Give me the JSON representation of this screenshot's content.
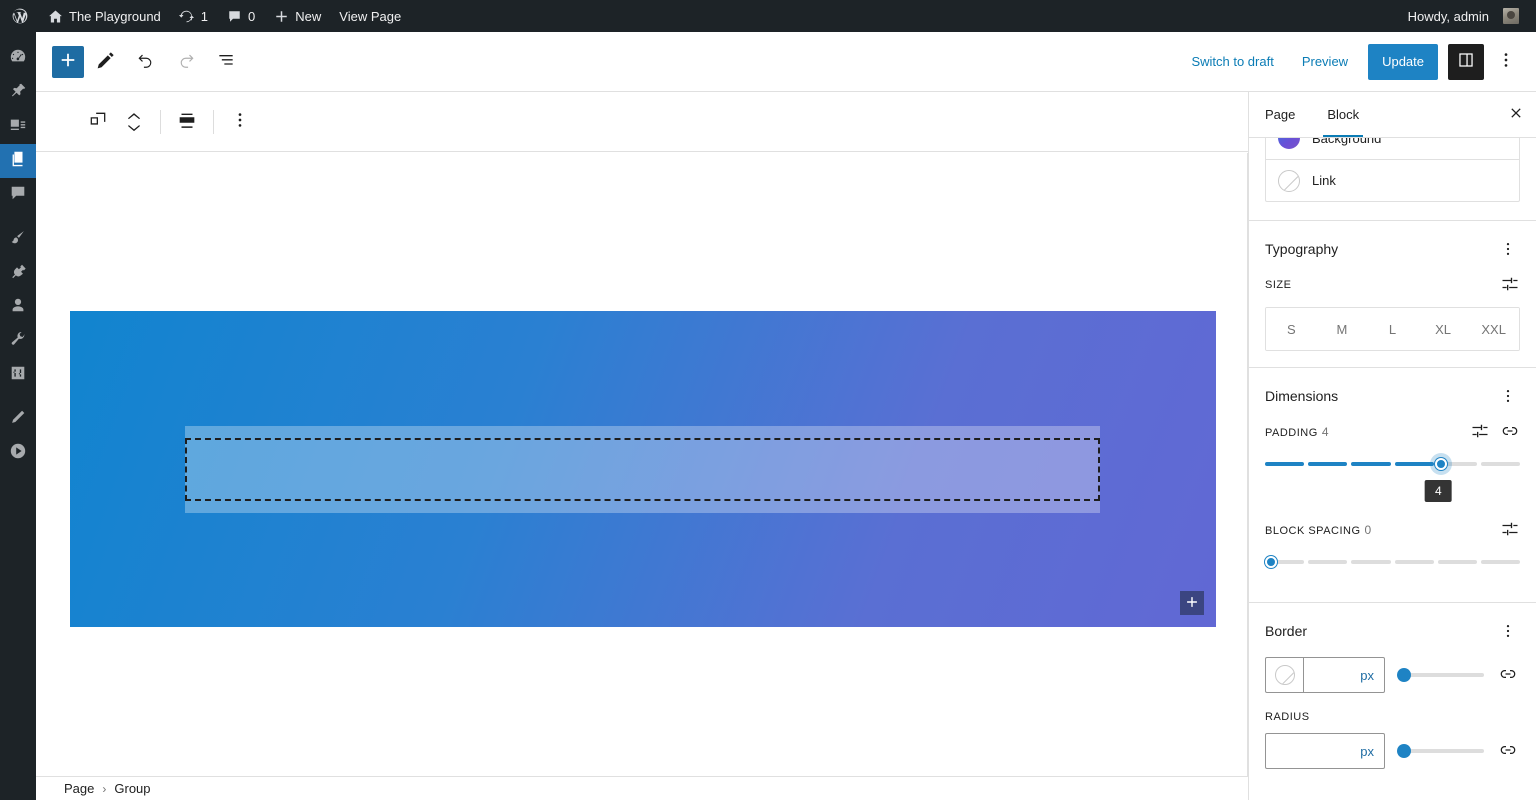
{
  "adminbar": {
    "logo_icon": "wordpress-logo-icon",
    "site_icon": "home-icon",
    "site_name": "The Playground",
    "revisions_icon": "updates-icon",
    "revisions_count": "1",
    "comments_icon": "comment-bubble-icon",
    "comments_count": "0",
    "new_icon": "plus-icon",
    "new_label": "New",
    "view_page_label": "View Page",
    "howdy": "Howdy, admin",
    "avatar_name": "user-avatar"
  },
  "adminmenu": {
    "items": [
      {
        "name": "dashboard",
        "icon": "dashboard-icon",
        "current": false
      },
      {
        "name": "posts",
        "icon": "pin-icon",
        "current": false
      },
      {
        "name": "media",
        "icon": "media-icon",
        "current": false
      },
      {
        "name": "pages",
        "icon": "pages-icon",
        "current": true
      },
      {
        "name": "comments",
        "icon": "comment-icon",
        "current": false
      },
      {
        "name": "appearance",
        "icon": "paintbrush-icon",
        "current": false
      },
      {
        "name": "plugins",
        "icon": "plug-icon",
        "current": false
      },
      {
        "name": "users",
        "icon": "user-icon",
        "current": false
      },
      {
        "name": "tools",
        "icon": "wrench-icon",
        "current": false
      },
      {
        "name": "settings",
        "icon": "sliders-icon",
        "current": false
      },
      {
        "name": "edit",
        "icon": "pencil-icon",
        "current": false
      },
      {
        "name": "player",
        "icon": "play-icon",
        "current": false
      }
    ]
  },
  "header": {
    "add_block_icon": "plus-icon",
    "tools_icon": "pencil-icon",
    "undo_icon": "undo-icon",
    "redo_icon": "redo-icon",
    "list_view_icon": "list-view-icon",
    "switch_to_draft": "Switch to draft",
    "preview": "Preview",
    "update": "Update",
    "sidebar_toggle_icon": "sidebar-panel-icon",
    "options_icon": "more-options-icon",
    "accent_color": "#1e83c4",
    "link_color": "#0b7cb5"
  },
  "block_toolbar": {
    "block_type_icon": "group-block-icon",
    "move_up_icon": "chevron-up-icon",
    "move_down_icon": "chevron-down-icon",
    "align_icon": "align-center-icon",
    "options_icon": "more-options-icon"
  },
  "canvas": {
    "block_gradient_start": "#1184cf",
    "block_gradient_end": "#6168d4",
    "inner_block_overlay": "rgba(255,255,255,0.30)",
    "selection_style": "dashed",
    "appender_icon": "plus-icon"
  },
  "footer": {
    "breadcrumb": [
      "Page",
      "Group"
    ],
    "separator": "›"
  },
  "settings": {
    "tabs": [
      {
        "label": "Page",
        "active": false
      },
      {
        "label": "Block",
        "active": true
      }
    ],
    "close_icon": "close-icon",
    "colors": [
      {
        "label": "Background",
        "swatch": "gradient",
        "swatch_color": "#6a4fd6"
      },
      {
        "label": "Link",
        "swatch": "none",
        "swatch_color": ""
      }
    ],
    "typography": {
      "title": "Typography",
      "options_icon": "more-options-icon",
      "size_label": "SIZE",
      "size_toggle_icon": "settings-sliders-icon",
      "sizes": [
        "S",
        "M",
        "L",
        "XL",
        "XXL"
      ],
      "selected_size": ""
    },
    "dimensions": {
      "title": "Dimensions",
      "options_icon": "more-options-icon",
      "padding_label": "PADDING",
      "padding_value": "4",
      "padding_segments": 6,
      "padding_filled": 4,
      "padding_tooltip": "4",
      "padding_toggle_icon": "settings-sliders-icon",
      "padding_link_icon": "link-sides-icon",
      "block_spacing_label": "BLOCK SPACING",
      "block_spacing_value": "0",
      "block_spacing_segments": 6,
      "block_spacing_filled": 0,
      "block_spacing_toggle_icon": "settings-sliders-icon"
    },
    "border": {
      "title": "Border",
      "options_icon": "more-options-icon",
      "width_swatch_icon": "no-color-icon",
      "width_unit": "px",
      "width_link_icon": "link-sides-icon",
      "radius_label": "RADIUS",
      "radius_unit": "px",
      "radius_link_icon": "link-sides-icon"
    }
  }
}
